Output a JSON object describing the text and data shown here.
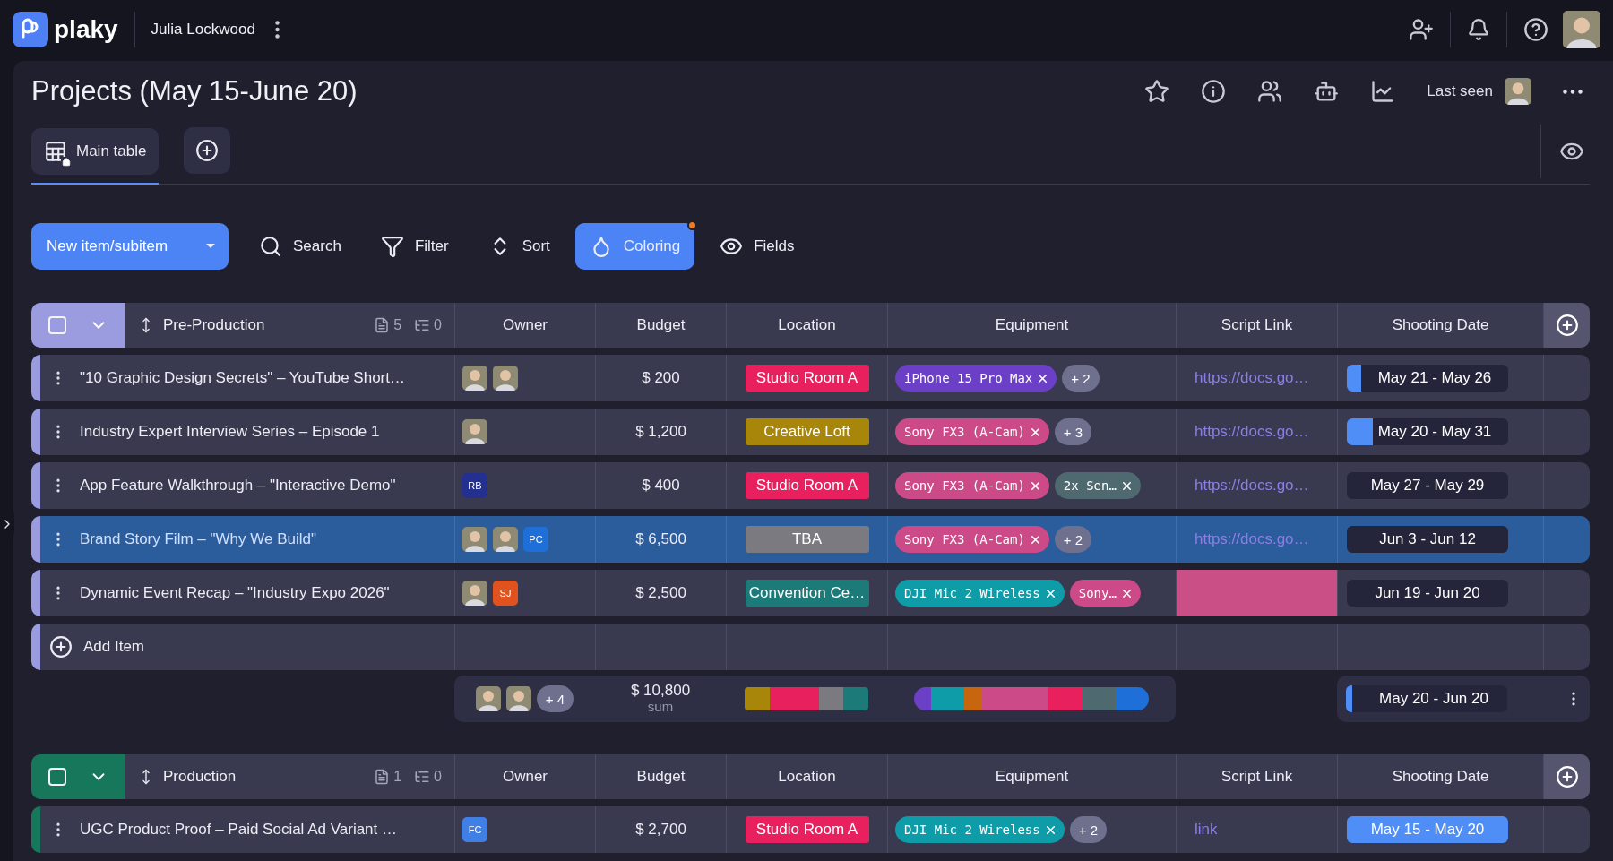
{
  "app": {
    "logo": "plaky",
    "workspace": "Julia Lockwood"
  },
  "board": {
    "title": "Projects (May 15-June 20)",
    "last_seen": "Last seen"
  },
  "views": [
    {
      "label": "Main table",
      "selected": true
    }
  ],
  "toolbar": {
    "primary": "New item/subitem",
    "tools": [
      {
        "kind": "search",
        "label": "Search",
        "active": false,
        "notice": false
      },
      {
        "kind": "filter",
        "label": "Filter",
        "active": false,
        "notice": false
      },
      {
        "kind": "sort",
        "label": "Sort",
        "active": false,
        "notice": false
      },
      {
        "kind": "coloring",
        "label": "Coloring",
        "active": true,
        "notice": true
      },
      {
        "kind": "fields",
        "label": "Fields",
        "active": false,
        "notice": false
      }
    ]
  },
  "groups": [
    {
      "name": "Pre-Production",
      "color": "#9b9be0",
      "checked": false,
      "expanded": true,
      "file_count": "5",
      "subitem_count": "0",
      "columns": [
        "Owner",
        "Budget",
        "Location",
        "Equipment",
        "Script Link",
        "Shooting Date"
      ],
      "items": [
        {
          "title": "\"10 Graphic Design Secrets\" – YouTube Short…",
          "selected": false,
          "owners": [
            {
              "kind": "photo"
            },
            {
              "kind": "photo"
            }
          ],
          "budget": "$ 200",
          "location": {
            "label": "Studio Room A",
            "color": "#e8205e"
          },
          "equipment": [
            {
              "kind": "tag",
              "label": "iPhone 15 Pro Max",
              "color": "#6b3fc6"
            },
            {
              "kind": "more",
              "label": "+ 2"
            }
          ],
          "script": {
            "kind": "link",
            "text": "https://docs.go…"
          },
          "date": {
            "label": "May 21 - May 26",
            "level": 0.09
          }
        },
        {
          "title": "Industry Expert Interview Series – Episode 1",
          "selected": false,
          "owners": [
            {
              "kind": "photo"
            }
          ],
          "budget": "$ 1,200",
          "location": {
            "label": "Creative Loft",
            "color": "#a8860a"
          },
          "equipment": [
            {
              "kind": "tag",
              "label": "Sony FX3 (A-Cam)",
              "color": "#cc4a88"
            },
            {
              "kind": "more",
              "label": "+ 3"
            }
          ],
          "script": {
            "kind": "link",
            "text": "https://docs.go…"
          },
          "date": {
            "label": "May 20 - May 31",
            "level": 0.16
          }
        },
        {
          "title": "App Feature Walkthrough – \"Interactive Demo\"",
          "selected": false,
          "owners": [
            {
              "kind": "initials",
              "initials": "RB",
              "color": "#24308f"
            }
          ],
          "budget": "$ 400",
          "location": {
            "label": "Studio Room A",
            "color": "#e8205e"
          },
          "equipment": [
            {
              "kind": "tag",
              "label": "Sony FX3 (A-Cam)",
              "color": "#cc4a88"
            },
            {
              "kind": "tag",
              "label": "2x Sen…",
              "color": "#4e6a70"
            }
          ],
          "script": {
            "kind": "link",
            "text": "https://docs.go…"
          },
          "date": {
            "label": "May 27 - May 29"
          }
        },
        {
          "title": "Brand Story Film – \"Why We Build\"",
          "selected": true,
          "owners": [
            {
              "kind": "photo"
            },
            {
              "kind": "photo"
            },
            {
              "kind": "initials",
              "initials": "PC",
              "color": "#1f6fd8"
            }
          ],
          "budget": "$ 6,500",
          "location": {
            "label": "TBA",
            "color": "#7a7a80"
          },
          "equipment": [
            {
              "kind": "tag",
              "label": "Sony FX3 (A-Cam)",
              "color": "#cc4a88"
            },
            {
              "kind": "more",
              "label": "+ 2"
            }
          ],
          "script": {
            "kind": "link",
            "text": "https://docs.go…"
          },
          "date": {
            "label": "Jun 3 - Jun 12"
          }
        },
        {
          "title": "Dynamic Event Recap – \"Industry Expo 2026\"",
          "selected": false,
          "owners": [
            {
              "kind": "photo"
            },
            {
              "kind": "initials",
              "initials": "SJ",
              "color": "#e2521e"
            }
          ],
          "budget": "$ 2,500",
          "location": {
            "label": "Convention Ce…",
            "color": "#1c7a78"
          },
          "equipment": [
            {
              "kind": "tag",
              "label": "DJI Mic 2 Wireless",
              "color": "#0e9ca8"
            },
            {
              "kind": "tag",
              "label": "Sony…",
              "color": "#cc4a88"
            }
          ],
          "script": {
            "kind": "fill",
            "color": "#c94f86"
          },
          "date": {
            "label": "Jun 19 - Jun 20"
          }
        }
      ],
      "add_item": "Add Item",
      "summary": {
        "owners": [
          {
            "kind": "photo"
          },
          {
            "kind": "photo"
          }
        ],
        "more": "+ 4",
        "budget": "$ 10,800",
        "budget_note": "sum",
        "location_colors": [
          {
            "color": "#a8860a"
          },
          {
            "color": "#e8205e"
          },
          {
            "color": "#e8205e"
          },
          {
            "color": "#7a7a80"
          },
          {
            "color": "#1c7a78"
          }
        ],
        "equipment_colors": [
          {
            "color": "#6b3fc6"
          },
          {
            "color": "#0e9ca8"
          },
          {
            "color": "#0e9ca8"
          },
          {
            "color": "#c8650f"
          },
          {
            "color": "#cc4a88"
          },
          {
            "color": "#cc4a88"
          },
          {
            "color": "#cc4a88"
          },
          {
            "color": "#cc4a88"
          },
          {
            "color": "#e8205e"
          },
          {
            "color": "#e8205e"
          },
          {
            "color": "#4e6a70"
          },
          {
            "color": "#4e6a70"
          },
          {
            "color": "#1f6fd8"
          },
          {
            "color": "#1f6fd8"
          }
        ],
        "date": {
          "label": "May 20 - Jun 20",
          "level": 0.04
        }
      }
    },
    {
      "name": "Production",
      "color": "#17775a",
      "checked": false,
      "expanded": true,
      "file_count": "1",
      "subitem_count": "0",
      "columns": [
        "Owner",
        "Budget",
        "Location",
        "Equipment",
        "Script Link",
        "Shooting Date"
      ],
      "items": [
        {
          "title": "UGC Product Proof – Paid Social Ad Variant …",
          "selected": false,
          "owners": [
            {
              "kind": "initials",
              "initials": "FC",
              "color": "#3f7fe6"
            }
          ],
          "budget": "$ 2,700",
          "location": {
            "label": "Studio Room A",
            "color": "#e8205e"
          },
          "equipment": [
            {
              "kind": "tag",
              "label": "DJI Mic 2 Wireless",
              "color": "#0e9ca8"
            },
            {
              "kind": "more",
              "label": "+ 2"
            }
          ],
          "script": {
            "kind": "link",
            "text": "link"
          },
          "date": {
            "label": "May 15 - May 20",
            "level": 1
          }
        }
      ]
    }
  ]
}
